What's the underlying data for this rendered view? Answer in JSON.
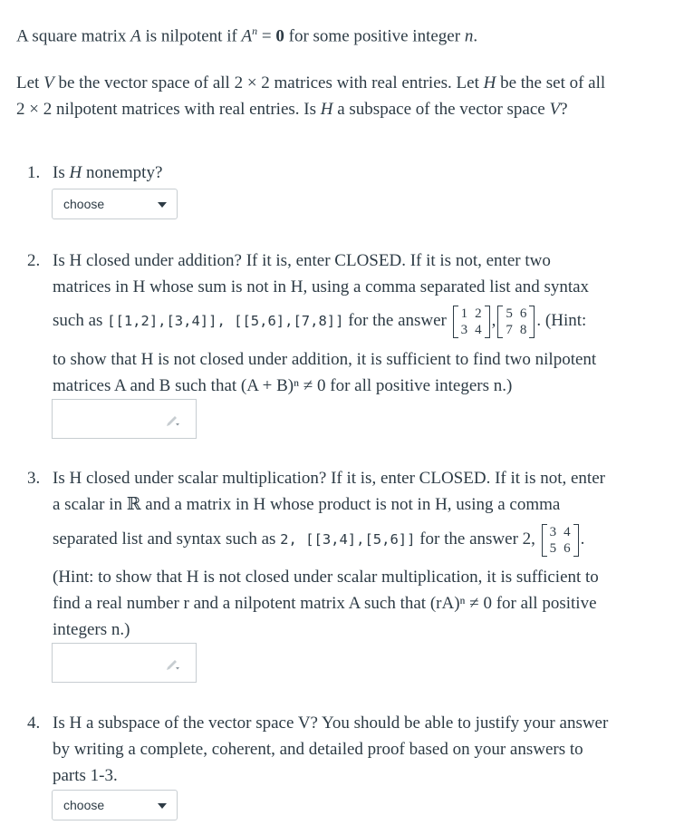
{
  "intro": {
    "line1_pre": "A square matrix ",
    "A": "A",
    "line1_mid": " is nilpotent if ",
    "An": "A",
    "exp_n": "n",
    "eq": " = ",
    "zero": "0",
    "line1_post": " for some positive integer ",
    "n": "n",
    "period": ".",
    "line2_pre": "Let ",
    "V": "V",
    "line2_mid": " be the vector space of all 2 × 2 matrices with real entries. Let ",
    "H": "H",
    "line2_post": " be the set of all",
    "line3_pre": "2 × 2 nilpotent matrices with real entries. Is ",
    "line3_mid": " a subspace of the vector space ",
    "line3_post": "?"
  },
  "questions": [
    {
      "number": "1.",
      "text_pre": "Is ",
      "H": "H",
      "text_post": " nonempty?",
      "control": "select",
      "selected": "choose"
    },
    {
      "number": "2.",
      "line1": "Is H closed under addition? If it is, enter CLOSED. If it is not, enter two",
      "line2": "matrices in H whose sum is not in H, using a comma separated list and syntax",
      "line3_pre": "such as ",
      "line3_code": "[[1,2],[3,4]], [[5,6],[7,8]]",
      "line3_post": " for the answer",
      "matrix1": [
        [
          "1",
          "2"
        ],
        [
          "3",
          "4"
        ]
      ],
      "matrix2": [
        [
          "5",
          "6"
        ],
        [
          "7",
          "8"
        ]
      ],
      "line3_hint": ". (Hint:",
      "line4": "to show that H is not closed under addition, it is sufficient to find two nilpotent",
      "line5": "matrices A and B such that (A + B)ⁿ ≠ 0 for all positive integers n.)",
      "control": "text",
      "value": ""
    },
    {
      "number": "3.",
      "line1": "Is H closed under scalar multiplication? If it is, enter CLOSED. If it is not, enter",
      "line2": "a scalar in ℝ and a matrix in H whose product is not in H, using a comma",
      "line3_pre": "separated list and syntax such as ",
      "line3_code": "2, [[3,4],[5,6]]",
      "line3_post": " for the answer 2,",
      "matrix": [
        [
          "3",
          "4"
        ],
        [
          "5",
          "6"
        ]
      ],
      "line3_end": ".",
      "line4": "(Hint: to show that H is not closed under scalar multiplication, it is sufficient to",
      "line5": "find a real number r and a nilpotent matrix A such that (rA)ⁿ ≠ 0 for all positive",
      "line6": "integers n.)",
      "control": "text",
      "value": ""
    },
    {
      "number": "4.",
      "line1": "Is H a subspace of the vector space V? You should be able to justify your answer",
      "line2": "by writing a complete, coherent, and detailed proof based on your answers to",
      "line3": "parts 1-3.",
      "control": "select",
      "selected": "choose"
    }
  ]
}
